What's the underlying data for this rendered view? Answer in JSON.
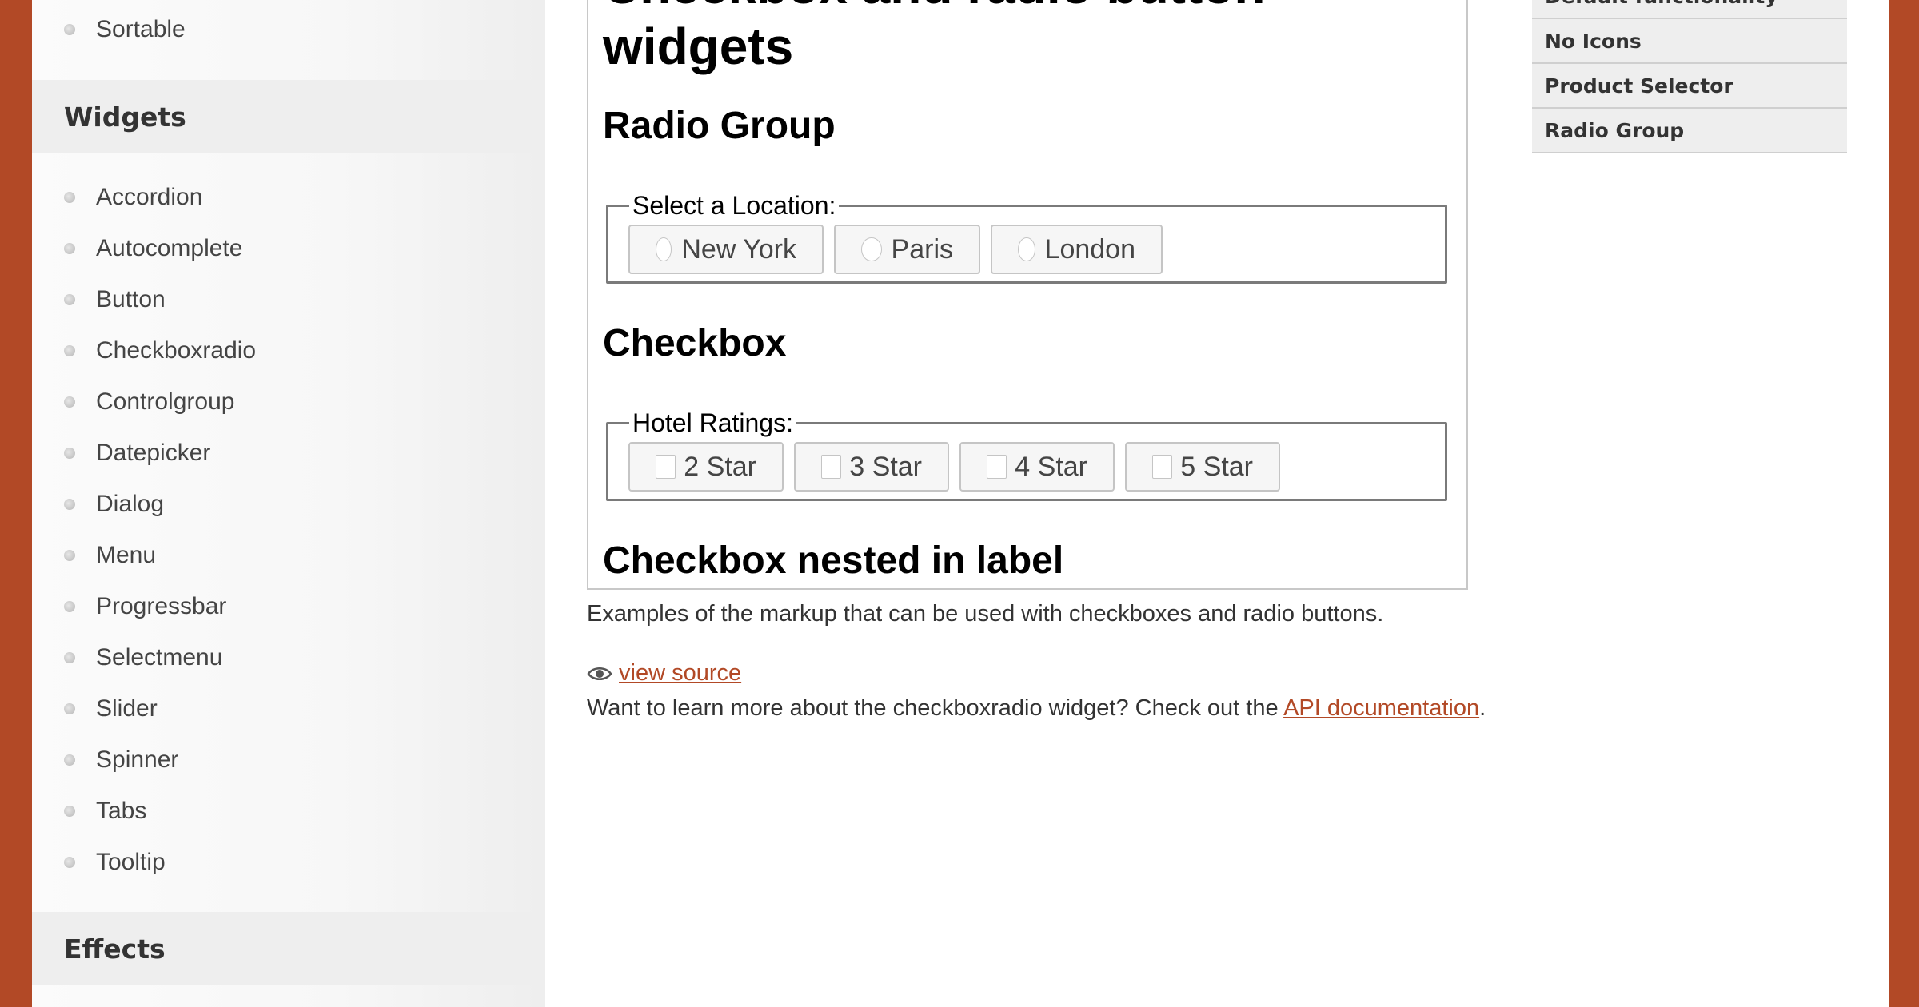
{
  "sidebar": {
    "top_item": "Sortable",
    "widgets_heading": "Widgets",
    "widgets": [
      "Accordion",
      "Autocomplete",
      "Button",
      "Checkboxradio",
      "Controlgroup",
      "Datepicker",
      "Dialog",
      "Menu",
      "Progressbar",
      "Selectmenu",
      "Slider",
      "Spinner",
      "Tabs",
      "Tooltip"
    ],
    "effects_heading": "Effects"
  },
  "demo": {
    "title": "Checkbox and radio button widgets",
    "radio_heading": "Radio Group",
    "radio_legend": "Select a Location:",
    "radio_options": [
      "New York",
      "Paris",
      "London"
    ],
    "checkbox_heading": "Checkbox",
    "checkbox_legend": "Hotel Ratings:",
    "checkbox_options": [
      "2 Star",
      "3 Star",
      "4 Star",
      "5 Star"
    ],
    "nested_heading": "Checkbox nested in label"
  },
  "description": "Examples of the markup that can be used with checkboxes and radio buttons.",
  "view_source": "view source",
  "learn_more": {
    "prefix": "Want to learn more about the checkboxradio widget? Check out the ",
    "link": "API documentation",
    "suffix": "."
  },
  "right_nav": [
    "Default functionality",
    "No Icons",
    "Product Selector",
    "Radio Group"
  ],
  "colors": {
    "brand": "#b24926",
    "sidebar_heading_bg": "#eeeeee",
    "button_bg": "#f6f6f6"
  },
  "icons": {
    "view_source": "eye-icon"
  }
}
